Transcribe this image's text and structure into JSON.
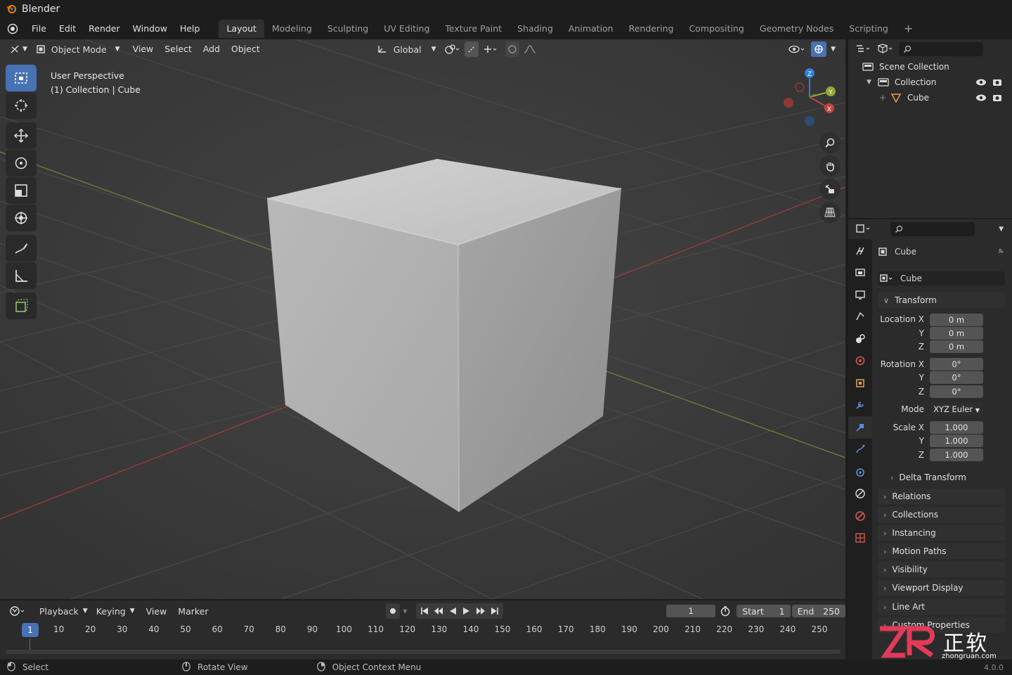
{
  "app": {
    "title": "Blender",
    "version": "4.0.0"
  },
  "menu": [
    "File",
    "Edit",
    "Render",
    "Window",
    "Help"
  ],
  "workspaces": [
    "Layout",
    "Modeling",
    "Sculpting",
    "UV Editing",
    "Texture Paint",
    "Shading",
    "Animation",
    "Rendering",
    "Compositing",
    "Geometry Nodes",
    "Scripting"
  ],
  "active_workspace": "Layout",
  "viewport": {
    "mode": "Object Mode",
    "menus": [
      "View",
      "Select",
      "Add",
      "Object"
    ],
    "transform_orientation": "Global",
    "overlay_line1": "User Perspective",
    "overlay_line2": "(1) Collection | Cube",
    "gizmo_axes": [
      "Z",
      "Y",
      "X"
    ]
  },
  "outliner": {
    "scene_collection": "Scene Collection",
    "collection": "Collection",
    "object": "Cube"
  },
  "properties": {
    "object_name": "Cube",
    "datablock_name": "Cube",
    "transform_title": "Transform",
    "location_label": "Location X",
    "rotation_label": "Rotation X",
    "scale_label": "Scale X",
    "y_label": "Y",
    "z_label": "Z",
    "location": [
      "0 m",
      "0 m",
      "0 m"
    ],
    "rotation": [
      "0°",
      "0°",
      "0°"
    ],
    "mode_label": "Mode",
    "mode_value": "XYZ Euler",
    "scale": [
      "1.000",
      "1.000",
      "1.000"
    ],
    "delta_transform": "Delta Transform",
    "panels": [
      "Relations",
      "Collections",
      "Instancing",
      "Motion Paths",
      "Visibility",
      "Viewport Display",
      "Line Art",
      "Custom Properties"
    ]
  },
  "timeline": {
    "menus": [
      "Playback",
      "Keying",
      "View",
      "Marker"
    ],
    "current_frame": "1",
    "start_label": "Start",
    "start_value": "1",
    "end_label": "End",
    "end_value": "250",
    "ruler_current": "1",
    "ticks": [
      "10",
      "20",
      "30",
      "40",
      "50",
      "60",
      "70",
      "80",
      "90",
      "100",
      "110",
      "120",
      "130",
      "140",
      "150",
      "160",
      "170",
      "180",
      "190",
      "200",
      "210",
      "220",
      "230",
      "240",
      "250"
    ]
  },
  "status": {
    "select": "Select",
    "rotate": "Rotate View",
    "context": "Object Context Menu"
  },
  "watermark": {
    "site": "zhongruan.com",
    "cn": "正软"
  },
  "colors": {
    "accent": "#4772b3",
    "viewport_bg": "#3d3d3d",
    "x_axis": "#c0453f",
    "y_axis": "#8fa93a",
    "z_axis": "#2f7fdb",
    "header": "#1d1d1d"
  }
}
